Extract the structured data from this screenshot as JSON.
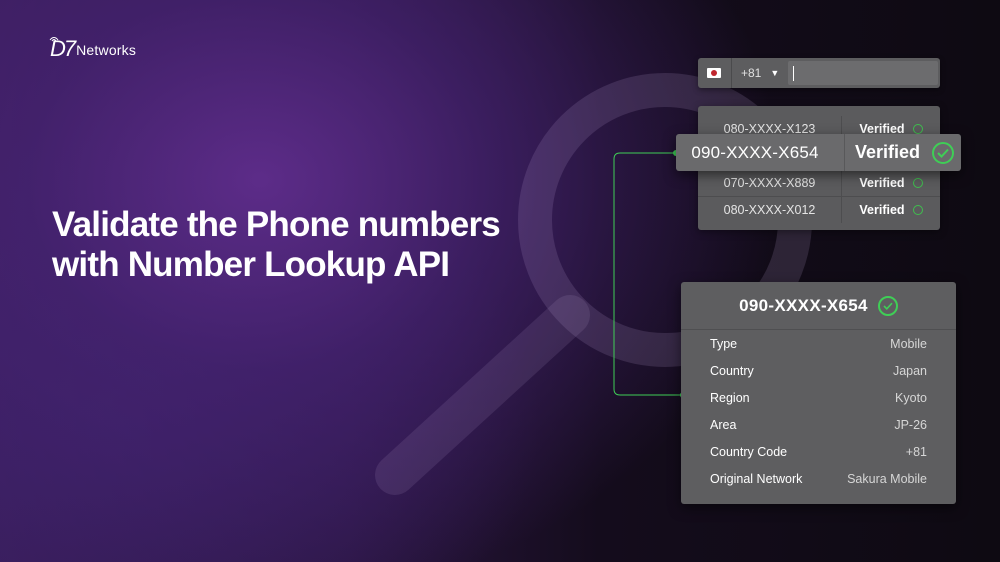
{
  "brand": {
    "logo_mark": "D7",
    "logo_text": "Networks"
  },
  "headline": {
    "line1": "Validate the Phone numbers",
    "line2": "with Number Lookup API"
  },
  "phone_input": {
    "flag_icon": "japan-flag-icon",
    "country_code": "+81",
    "dropdown_icon": "caret-down-icon",
    "value": ""
  },
  "number_list": {
    "rows": [
      {
        "number": "080-XXXX-X123",
        "status": "Verified"
      },
      {
        "number": "090-XXXX-X654",
        "status": "Verified"
      },
      {
        "number": "070-XXXX-X889",
        "status": "Verified"
      },
      {
        "number": "080-XXXX-X012",
        "status": "Verified"
      }
    ],
    "highlighted": {
      "number": "090-XXXX-X654",
      "status": "Verified"
    }
  },
  "details": {
    "title": "090-XXXX-X654",
    "fields": [
      {
        "label": "Type",
        "value": "Mobile"
      },
      {
        "label": "Country",
        "value": "Japan"
      },
      {
        "label": "Region",
        "value": "Kyoto"
      },
      {
        "label": "Area",
        "value": "JP-26"
      },
      {
        "label": "Country Code",
        "value": "+81"
      },
      {
        "label": "Original Network",
        "value": "Sakura Mobile"
      }
    ]
  },
  "colors": {
    "accent_green": "#3fce56",
    "panel_gray": "#5e5e60",
    "background_purple": "#3a1d5a"
  }
}
